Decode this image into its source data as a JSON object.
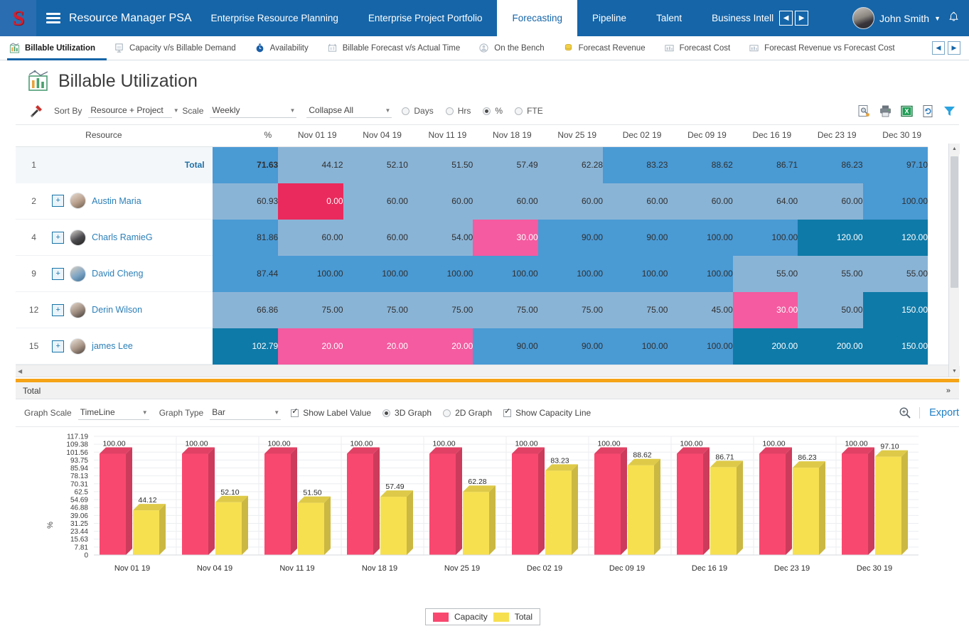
{
  "topnav": {
    "logo_letter": "S",
    "brand": "Resource Manager PSA",
    "items": [
      {
        "label": "Enterprise Resource Planning",
        "active": false
      },
      {
        "label": "Enterprise Project Portfolio",
        "active": false
      },
      {
        "label": "Forecasting",
        "active": true
      },
      {
        "label": "Pipeline",
        "active": false
      },
      {
        "label": "Talent",
        "active": false
      },
      {
        "label": "Business Intelligence",
        "active": false
      }
    ],
    "prev_label": "◀",
    "next_label": "▶",
    "user_name": "John Smith",
    "caret": "▼",
    "bell": "🔔"
  },
  "subtabs": {
    "items": [
      {
        "label": "Billable Utilization",
        "icon": "bar-chart-icon",
        "active": true
      },
      {
        "label": "Capacity v/s Billable Demand",
        "icon": "capacity-icon",
        "active": false
      },
      {
        "label": "Availability",
        "icon": "clock-icon",
        "active": false
      },
      {
        "label": "Billable Forecast v/s Actual Time",
        "icon": "forecast-icon",
        "active": false
      },
      {
        "label": "On the Bench",
        "icon": "bench-icon",
        "active": false
      },
      {
        "label": "Forecast Revenue",
        "icon": "coins-icon",
        "active": false
      },
      {
        "label": "Forecast Cost",
        "icon": "cost-chart-icon",
        "active": false
      },
      {
        "label": "Forecast Revenue vs Forecast Cost",
        "icon": "cost-chart-icon",
        "active": false
      }
    ],
    "prev_label": "◀",
    "next_label": "▶"
  },
  "page": {
    "title": "Billable Utilization"
  },
  "filterbar": {
    "sort_by_label": "Sort By",
    "sort_by_value": "Resource + Project",
    "scale_label": "Scale",
    "scale_value": "Weekly",
    "collapse_value": "Collapse All",
    "arrow": "▼",
    "units": [
      {
        "label": "Days",
        "selected": false
      },
      {
        "label": "Hrs",
        "selected": false
      },
      {
        "label": "%",
        "selected": true
      },
      {
        "label": "FTE",
        "selected": false
      }
    ],
    "tools": [
      "preview-icon",
      "print-icon",
      "excel-export-icon",
      "refresh-doc-icon",
      "filter-icon"
    ]
  },
  "grid": {
    "columns": [
      "",
      "Resource",
      "%",
      "Nov 01 19",
      "Nov 04 19",
      "Nov 11 19",
      "Nov 18 19",
      "Nov 25 19",
      "Dec 02 19",
      "Dec 09 19",
      "Dec 16 19",
      "Dec 23 19",
      "Dec 30 19"
    ],
    "total_row": {
      "index": "1",
      "label": "Total",
      "pct": "71.63",
      "values": [
        "44.12",
        "52.10",
        "51.50",
        "57.49",
        "62.28",
        "83.23",
        "88.62",
        "86.71",
        "86.23",
        "97.10"
      ],
      "pct_tier": "mid",
      "tiers": [
        "low",
        "low",
        "low",
        "low",
        "low",
        "mid",
        "mid",
        "mid",
        "mid",
        "mid"
      ]
    },
    "rows": [
      {
        "index": "2",
        "name": "Austin Maria",
        "pct": "60.93",
        "pct_tier": "low",
        "values": [
          "0.00",
          "60.00",
          "60.00",
          "60.00",
          "60.00",
          "60.00",
          "60.00",
          "64.00",
          "60.00",
          "100.00"
        ],
        "tiers": [
          "red",
          "low",
          "low",
          "low",
          "low",
          "low",
          "low",
          "low",
          "low",
          "mid"
        ]
      },
      {
        "index": "4",
        "name": "Charls RamieG",
        "pct": "81.86",
        "pct_tier": "mid",
        "values": [
          "60.00",
          "60.00",
          "54.00",
          "30.00",
          "90.00",
          "90.00",
          "100.00",
          "100.00",
          "120.00",
          "120.00"
        ],
        "tiers": [
          "low",
          "low",
          "low",
          "pink",
          "mid",
          "mid",
          "mid",
          "mid",
          "high",
          "high"
        ]
      },
      {
        "index": "9",
        "name": "David Cheng",
        "pct": "87.44",
        "pct_tier": "mid",
        "values": [
          "100.00",
          "100.00",
          "100.00",
          "100.00",
          "100.00",
          "100.00",
          "100.00",
          "55.00",
          "55.00",
          "55.00"
        ],
        "tiers": [
          "mid",
          "mid",
          "mid",
          "mid",
          "mid",
          "mid",
          "mid",
          "low",
          "low",
          "low"
        ]
      },
      {
        "index": "12",
        "name": "Derin Wilson",
        "pct": "66.86",
        "pct_tier": "low",
        "values": [
          "75.00",
          "75.00",
          "75.00",
          "75.00",
          "75.00",
          "75.00",
          "45.00",
          "30.00",
          "50.00",
          "150.00"
        ],
        "tiers": [
          "low",
          "low",
          "low",
          "low",
          "low",
          "low",
          "low",
          "pink",
          "low",
          "high"
        ]
      },
      {
        "index": "15",
        "name": "james Lee",
        "pct": "102.79",
        "pct_tier": "high",
        "values": [
          "20.00",
          "20.00",
          "20.00",
          "90.00",
          "90.00",
          "100.00",
          "100.00",
          "200.00",
          "200.00",
          "150.00"
        ],
        "tiers": [
          "pink",
          "pink",
          "pink",
          "mid",
          "mid",
          "mid",
          "mid",
          "high",
          "high",
          "high"
        ]
      }
    ]
  },
  "bottom": {
    "total_label": "Total",
    "collapse_icon": "»"
  },
  "graphctrl": {
    "graph_scale_label": "Graph Scale",
    "graph_scale_value": "TimeLine",
    "graph_type_label": "Graph Type",
    "graph_type_value": "Bar",
    "arrow": "▼",
    "show_label_value": {
      "label": "Show Label Value",
      "checked": true
    },
    "three_d": {
      "label": "3D Graph",
      "selected": true
    },
    "two_d": {
      "label": "2D Graph",
      "selected": false
    },
    "show_capacity_line": {
      "label": "Show Capacity Line",
      "checked": true
    },
    "zoom_icon": "zoom-in-icon",
    "export_label": "Export"
  },
  "colors": {
    "brand_blue": "#1565a8",
    "tier_low": "#8ab4d6",
    "tier_mid": "#4a9ad4",
    "tier_high": "#0e7aa8",
    "tier_pink": "#f45ba0",
    "tier_red": "#ea2a5c",
    "capacity_pink": "#f9486f",
    "total_yellow": "#f7e050",
    "orange_bar": "#f5a317"
  },
  "chart_data": {
    "type": "bar",
    "title": "",
    "xlabel": "",
    "ylabel": "%",
    "categories": [
      "Nov 01 19",
      "Nov 04 19",
      "Nov 11 19",
      "Nov 18 19",
      "Nov 25 19",
      "Dec 02 19",
      "Dec 09 19",
      "Dec 16 19",
      "Dec 23 19",
      "Dec 30 19"
    ],
    "series": [
      {
        "name": "Capacity",
        "color": "#f9486f",
        "values": [
          100.0,
          100.0,
          100.0,
          100.0,
          100.0,
          100.0,
          100.0,
          100.0,
          100.0,
          100.0
        ],
        "labels": [
          "100.00",
          "100.00",
          "100.00",
          "100.00",
          "100.00",
          "100.00",
          "100.00",
          "100.00",
          "100.00",
          "100.00"
        ]
      },
      {
        "name": "Total",
        "color": "#f7e050",
        "values": [
          44.12,
          52.1,
          51.5,
          57.49,
          62.28,
          83.23,
          88.62,
          86.71,
          86.23,
          97.1
        ],
        "labels": [
          "44.12",
          "52.10",
          "51.50",
          "57.49",
          "62.28",
          "83.23",
          "88.62",
          "86.71",
          "86.23",
          "97.10"
        ]
      }
    ],
    "yticks": [
      "117.19",
      "109.38",
      "101.56",
      "93.75",
      "85.94",
      "78.13",
      "70.31",
      "62.5",
      "54.69",
      "46.88",
      "39.06",
      "31.25",
      "23.44",
      "15.63",
      "7.81",
      "0"
    ],
    "ylim": [
      0,
      117.19
    ],
    "grid": true,
    "legend_position": "bottom",
    "legend": [
      "Capacity",
      "Total"
    ]
  }
}
